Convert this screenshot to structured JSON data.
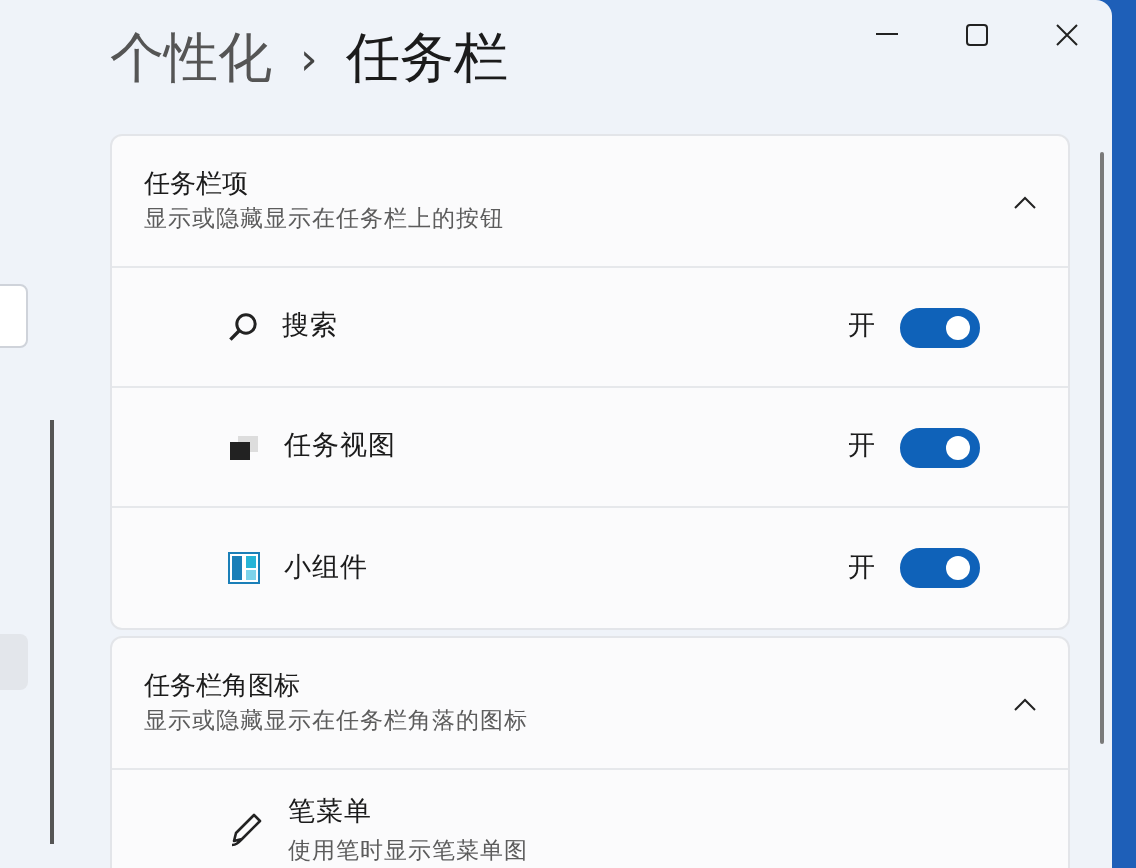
{
  "breadcrumb": {
    "parent": "个性化",
    "separator": "›",
    "current": "任务栏"
  },
  "sections": [
    {
      "title": "任务栏项",
      "subtitle": "显示或隐藏显示在任务栏上的按钮",
      "expanded": true,
      "items": [
        {
          "kind": "toggle",
          "label": "搜索",
          "state_text": "开",
          "on": true
        },
        {
          "kind": "toggle",
          "label": "任务视图",
          "state_text": "开",
          "on": true
        },
        {
          "kind": "toggle",
          "label": "小组件",
          "state_text": "开",
          "on": true
        }
      ]
    },
    {
      "title": "任务栏角图标",
      "subtitle": "显示或隐藏显示在任务栏角落的图标",
      "expanded": true,
      "items": [
        {
          "kind": "described",
          "label": "笔菜单",
          "description": "使用笔时显示笔菜单图"
        }
      ]
    }
  ]
}
